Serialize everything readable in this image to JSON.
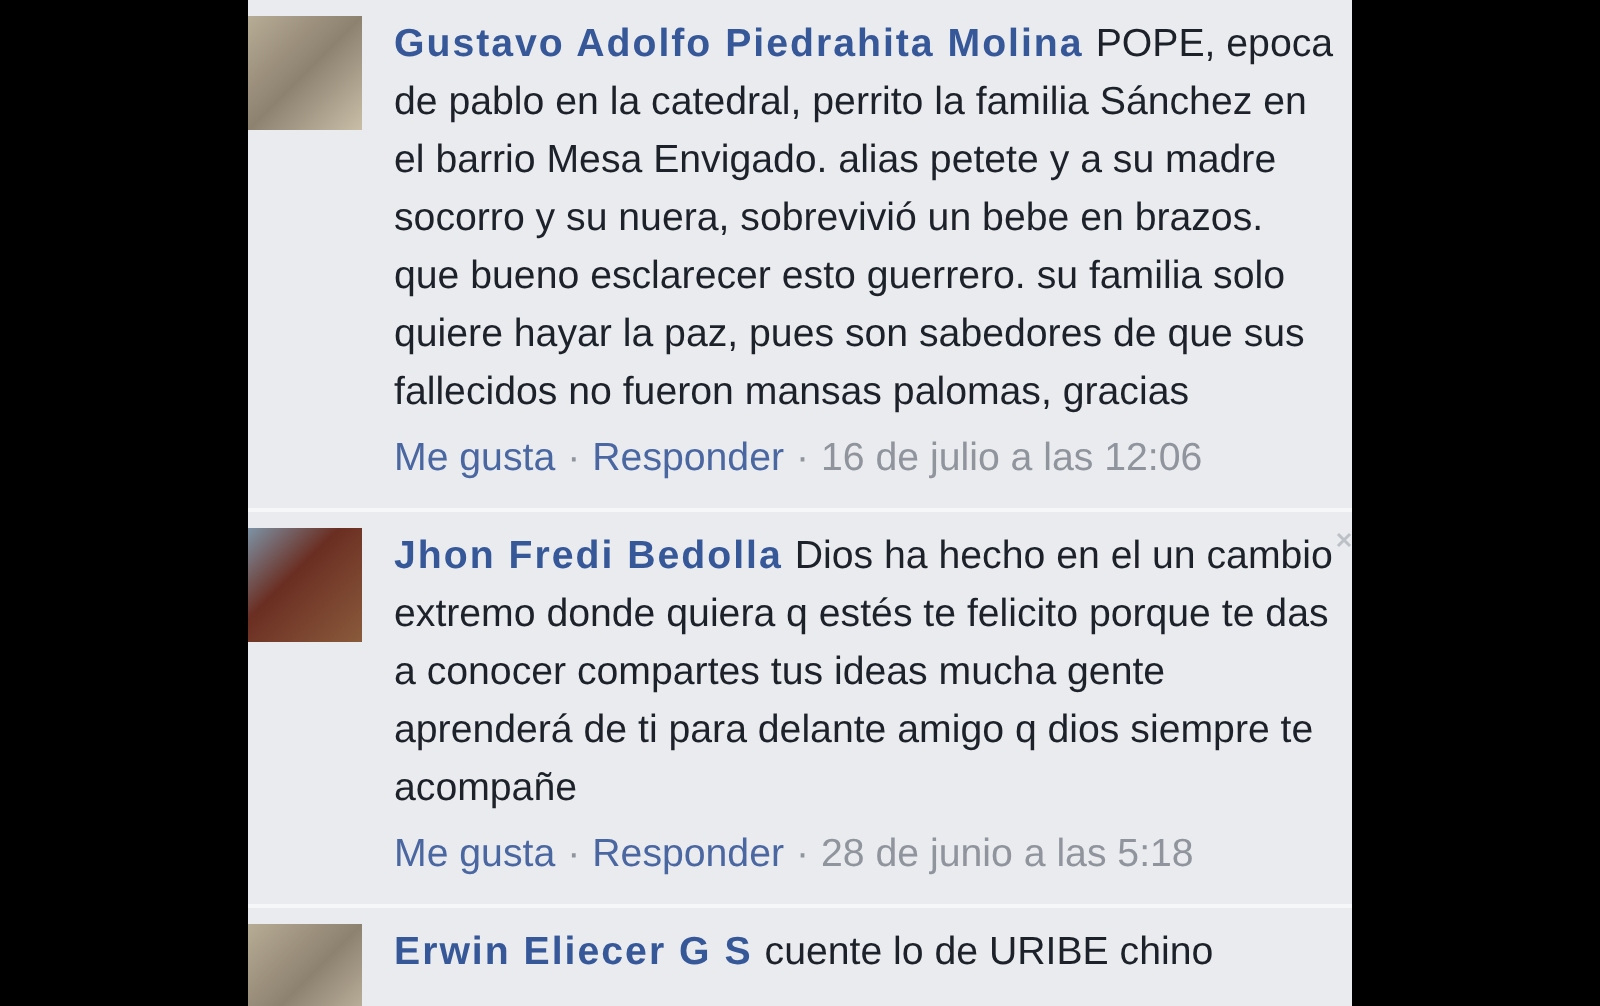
{
  "comments": [
    {
      "author": "Gustavo Adolfo Piedrahita Molina",
      "text": "POPE, epoca de pablo en la catedral, perrito la familia Sánchez en el barrio Mesa Envigado. alias petete y a su madre socorro y su nuera, sobrevivió un bebe en brazos. que bueno esclarecer esto guerrero. su familia solo quiere hayar la paz, pues son sabedores de que sus fallecidos no fueron mansas palomas, gracias",
      "like": "Me gusta",
      "separator": "·",
      "reply": "Responder",
      "time": "16 de julio a las 12:06",
      "close": false
    },
    {
      "author": "Jhon Fredi Bedolla",
      "text": "Dios ha hecho en el un cambio extremo donde quiera q estés te felicito porque te das a conocer compartes tus ideas mucha gente aprenderá de ti para delante amigo q dios siempre te acompañe",
      "like": "Me gusta",
      "separator": "·",
      "reply": "Responder",
      "time": "28 de junio a las 5:18",
      "close": true
    },
    {
      "author": "Erwin Eliecer G S",
      "text": "cuente lo de URIBE chino",
      "close": false
    }
  ]
}
